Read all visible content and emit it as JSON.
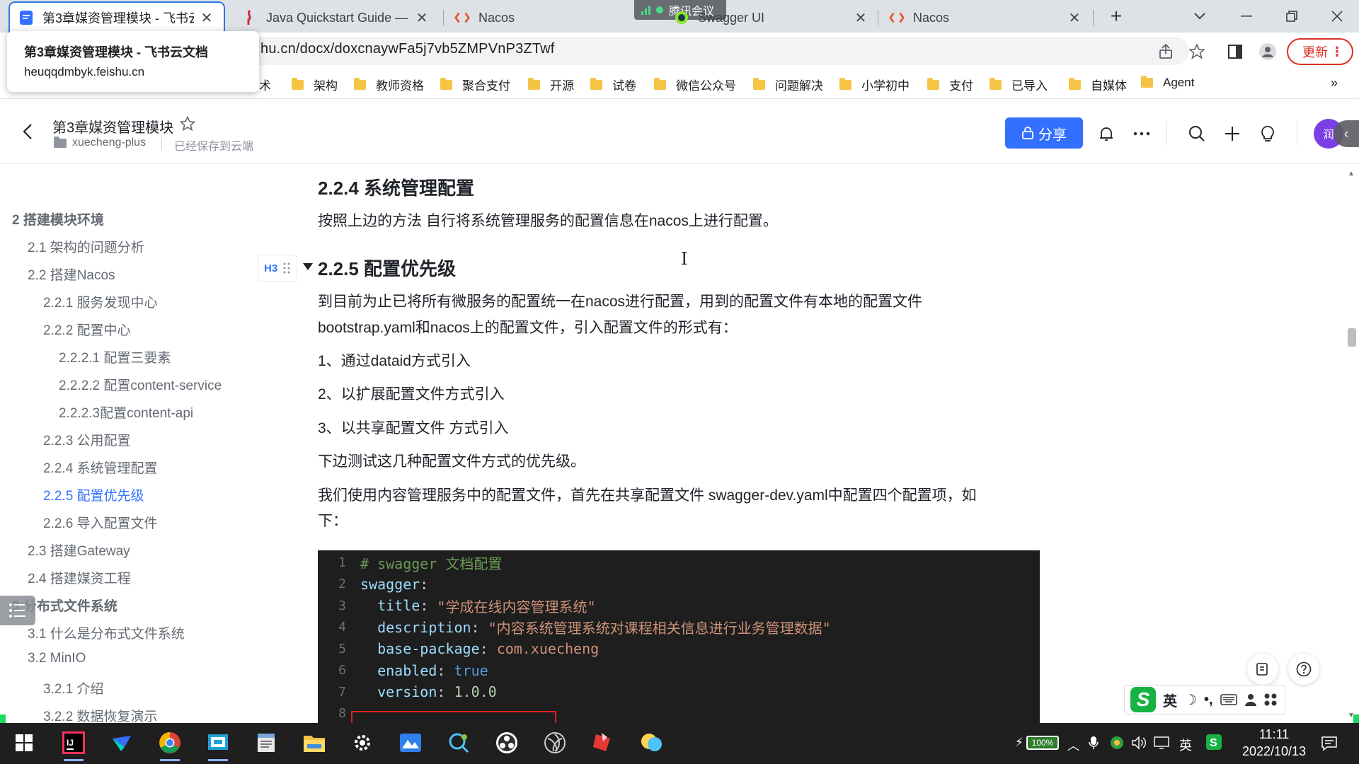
{
  "browser": {
    "tabs": [
      {
        "title": "第3章媒资管理模块 - 飞书云文档",
        "active": true
      },
      {
        "title": "Java Quickstart Guide — MinIO",
        "active": false
      },
      {
        "title": "Nacos",
        "active": false
      },
      {
        "title": "Swagger UI",
        "active": false
      },
      {
        "title": "Nacos",
        "active": false
      }
    ],
    "new_tab": "+",
    "meeting_overlay": "腾讯会议",
    "url": "hu.cn/docx/doxcnaywFa5j7vb5ZMPVnP3ZTwf",
    "update_button": "更新",
    "hover_card": {
      "title": "第3章媒资管理模块 - 飞书云文档",
      "domain": "heuqqdmbyk.feishu.cn"
    },
    "bookmarks": [
      "术",
      "架构",
      "教师资格",
      "聚合支付",
      "开源",
      "试卷",
      "微信公众号",
      "问题解决",
      "小学初中",
      "支付",
      "已导入",
      "自媒体",
      "Agent"
    ],
    "bookmarks_more": "»"
  },
  "doc_header": {
    "title": "第3章媒资管理模块",
    "folder": "xuecheng-plus",
    "status": "已经保存到云端",
    "share_label": "分享",
    "avatar_text": "润"
  },
  "toc": {
    "items": [
      {
        "label": "2 搭建模块环境",
        "level": 1
      },
      {
        "label": "2.1 架构的问题分析",
        "level": 2
      },
      {
        "label": "2.2 搭建Nacos",
        "level": 2
      },
      {
        "label": "2.2.1 服务发现中心",
        "level": 3
      },
      {
        "label": "2.2.2 配置中心",
        "level": 3
      },
      {
        "label": "2.2.2.1 配置三要素",
        "level": 4
      },
      {
        "label": "2.2.2.2 配置content-service",
        "level": 4
      },
      {
        "label": "2.2.2.3配置content-api",
        "level": 4
      },
      {
        "label": "2.2.3 公用配置",
        "level": 3
      },
      {
        "label": "2.2.4 系统管理配置",
        "level": 3
      },
      {
        "label": "2.2.5 配置优先级",
        "level": 3,
        "active": true
      },
      {
        "label": "2.2.6 导入配置文件",
        "level": 3
      },
      {
        "label": "2.3 搭建Gateway",
        "level": 2
      },
      {
        "label": "2.4 搭建媒资工程",
        "level": 2
      },
      {
        "label": "3 分布式文件系统",
        "level": 1
      },
      {
        "label": "3.1 什么是分布式文件系统",
        "level": 2
      },
      {
        "label": "3.2 MinIO",
        "level": 2
      },
      {
        "label": "3.2.1 介绍",
        "level": 3
      },
      {
        "label": "3.2.2 数据恢复演示",
        "level": 3
      }
    ]
  },
  "content": {
    "h_224": "2.2.4 系统管理配置",
    "p_224": "按照上边的方法 自行将系统管理服务的配置信息在nacos上进行配置。",
    "h3_tag": "H3",
    "h_225": "2.2.5 配置优先级",
    "p1_line1": "到目前为止已将所有微服务的配置统一在nacos进行配置，用到的配置文件有本地的配置文件",
    "p1_line2": "bootstrap.yaml和nacos上的配置文件，引入配置文件的形式有：",
    "list1": "1、通过dataid方式引入",
    "list2": "2、以扩展配置文件方式引入",
    "list3": "3、以共享配置文件 方式引入",
    "p2": "下边测试这几种配置文件方式的优先级。",
    "p3_line1": "我们使用内容管理服务中的配置文件，首先在共享配置文件 swagger-dev.yaml中配置四个配置项，如",
    "p3_line2": "下："
  },
  "code": {
    "lines": [
      {
        "n": "1",
        "indent": "",
        "key": "",
        "sep": "",
        "value": "",
        "comment": "# swagger 文档配置",
        "vtype": ""
      },
      {
        "n": "2",
        "indent": "",
        "key": "swagger",
        "sep": ":",
        "value": "",
        "comment": "",
        "vtype": ""
      },
      {
        "n": "3",
        "indent": "  ",
        "key": "title",
        "sep": ": ",
        "value": "\"学成在线内容管理系统\"",
        "comment": "",
        "vtype": "str"
      },
      {
        "n": "4",
        "indent": "  ",
        "key": "description",
        "sep": ": ",
        "value": "\"内容系统管理系统对课程相关信息进行业务管理数据\"",
        "comment": "",
        "vtype": "str"
      },
      {
        "n": "5",
        "indent": "  ",
        "key": "base-package",
        "sep": ": ",
        "value": "com.xuecheng",
        "comment": "",
        "vtype": "str"
      },
      {
        "n": "6",
        "indent": "  ",
        "key": "enabled",
        "sep": ": ",
        "value": "true",
        "comment": "",
        "vtype": "kw"
      },
      {
        "n": "7",
        "indent": "  ",
        "key": "version",
        "sep": ": ",
        "value": "1.0.0",
        "comment": "",
        "vtype": "num"
      },
      {
        "n": "8",
        "indent": "",
        "key": "",
        "sep": "",
        "value": "",
        "comment": "",
        "vtype": ""
      }
    ]
  },
  "ime": {
    "mode": "英"
  },
  "taskbar": {
    "battery": "100%",
    "input_lang": "英",
    "time": "11:11",
    "date": "2022/10/13"
  },
  "colors": {
    "accent": "#3370ff",
    "update_red": "#d93025",
    "code_bg": "#1e1e1e"
  }
}
